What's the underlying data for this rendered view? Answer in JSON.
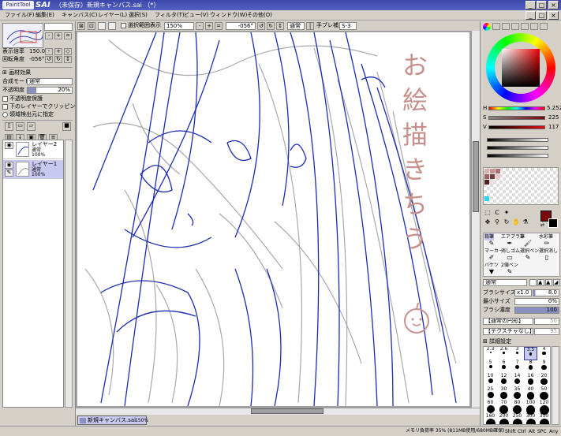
{
  "window": {
    "logo": "PaintTool",
    "app": "SAI",
    "title": "（未保存）新規キャンバス.sai （*）",
    "minimize": "_",
    "maximize": "□",
    "close": "×"
  },
  "menu": [
    "ファイル(F)",
    "編集(E)",
    "キャンバス(C)",
    "レイヤー(L)",
    "選択(S)",
    "フィルタ(T)",
    "ビュー(V)",
    "ウィンドウ(W)",
    "その他(O)"
  ],
  "navigator": {
    "zoom_label": "表示倍率",
    "zoom_value": "150.0%",
    "angle_label": "回転角度",
    "angle_value": "-056°"
  },
  "layer_panel": {
    "effects": "画材効果",
    "blend_label": "合成モード",
    "blend_value": "通常",
    "opacity_label": "不透明度",
    "opacity_value": "20%",
    "protect": "不透明度保護",
    "clip": "下のレイヤーでクリッピング",
    "select_src": "領域検出元に指定",
    "layers": [
      {
        "name": "レイヤー2",
        "mode": "通常",
        "opacity": "100%"
      },
      {
        "name": "レイヤー1",
        "mode": "通常",
        "opacity": "100%"
      }
    ]
  },
  "toolbar": {
    "sel_toggle": "選択範囲表示",
    "zoom": "150%",
    "angle": "-056°",
    "blend": "通常",
    "stab_label": "手ブレ補正",
    "stab": "S-3"
  },
  "canvas_text": {
    "heading": "お絵描きちう"
  },
  "doc_tab": {
    "name": "新規キャンバス.sai",
    "zoom": "150%"
  },
  "status": {
    "memory": "メモリ負荷率 35% (811MB使用/680MB確保)",
    "keys": [
      "Shift",
      "Ctrl",
      "Alt",
      "SPC"
    ],
    "any": "Any"
  },
  "color": {
    "H_label": "H",
    "H": "5.252",
    "S_label": "S",
    "S": "225",
    "V_label": "V",
    "V": "117",
    "primary": "#7a0808"
  },
  "tools": {
    "pen": "鉛筆",
    "airbrush": "エアブラシ",
    "brush": "筆",
    "watercolor": "水彩筆",
    "marker": "マーカー",
    "eraser": "消しゴム",
    "sel_pen": "選択ペン",
    "sel_erase": "選択消し",
    "bucket": "バケツ",
    "binary": "2値ペン"
  },
  "brush": {
    "mode": "通常",
    "size_label": "ブラシサイズ",
    "size_mult": "x1.0",
    "size": "8.0",
    "min_label": "最小サイズ",
    "min": "0%",
    "density_label": "ブラシ濃度",
    "density": "100",
    "shape": "【通常の円形】",
    "shape_val": "50",
    "texture": "【テクスチャなし】",
    "texture_val": "95",
    "advanced": "詳細設定",
    "sizes": [
      "2.3",
      "2.6",
      "3",
      "3.5",
      "4",
      "5",
      "6",
      "7",
      "8",
      "9",
      "10",
      "12",
      "14",
      "16",
      "20",
      "25",
      "30",
      "35",
      "40",
      "50",
      "60",
      "70",
      "80",
      "100",
      "120",
      "160",
      "200",
      "250",
      "300",
      "350"
    ]
  },
  "colors": {
    "chrome": "#d4d0c8",
    "title": "#3b47a8",
    "sketch_blue": "#1c2cb0",
    "sketch_gray": "#9a9a9a",
    "sketch_pink": "#c8908c"
  }
}
